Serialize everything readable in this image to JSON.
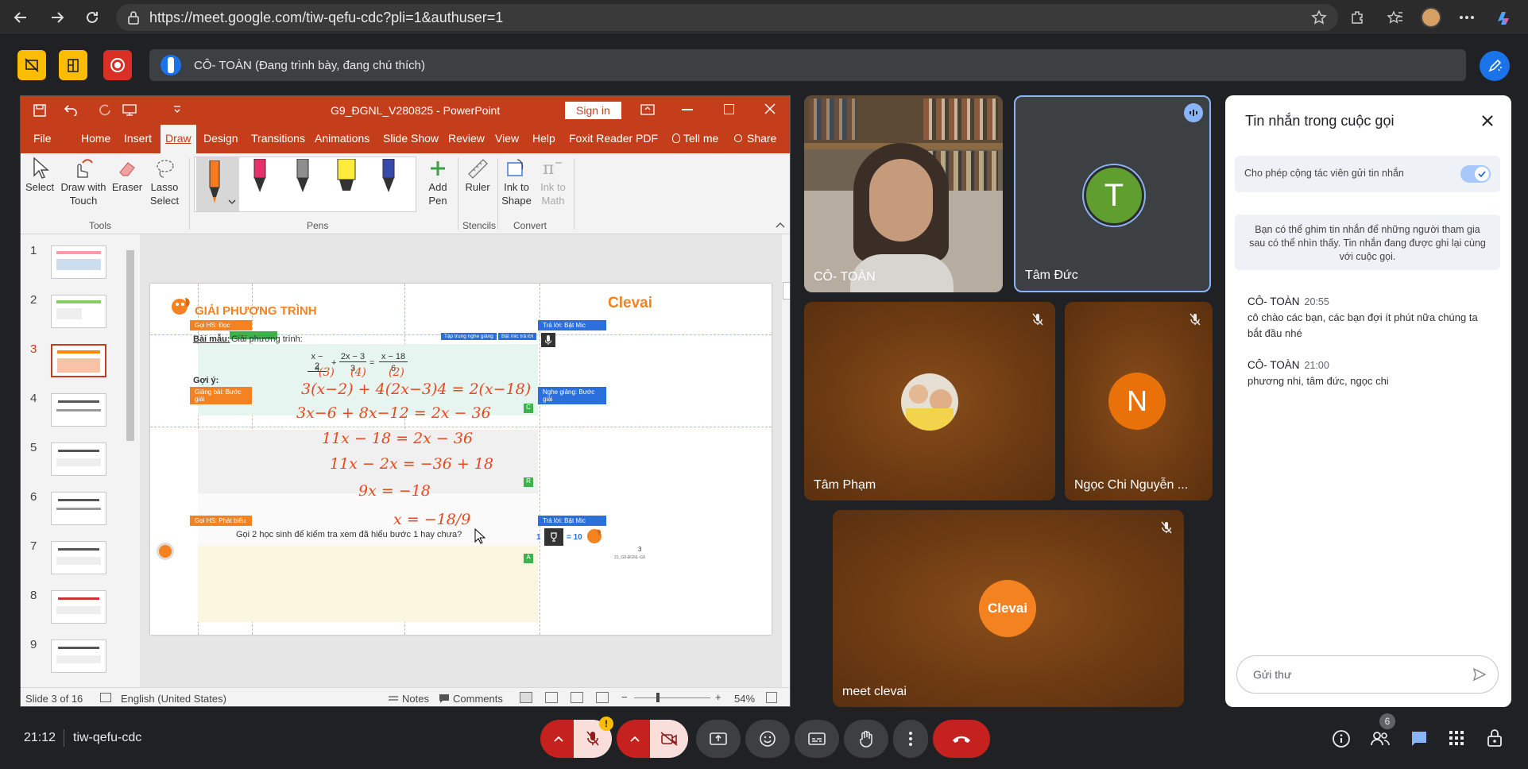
{
  "browser": {
    "url": "https://meet.google.com/tiw-qefu-cdc?pli=1&authuser=1"
  },
  "presentation_bar": {
    "text": "CÔ- TOÀN (Đang trình bày, đang chú thích)"
  },
  "ppt": {
    "file_title": "G9_ĐGNL_V280825  -  PowerPoint",
    "sign_in": "Sign in",
    "tabs": [
      "File",
      "Home",
      "Insert",
      "Draw",
      "Design",
      "Transitions",
      "Animations",
      "Slide Show",
      "Review",
      "View",
      "Help",
      "Foxit Reader PDF",
      "Tell me",
      "Share"
    ],
    "ribbon": {
      "select": "Select",
      "draw_touch": "Draw with Touch",
      "eraser": "Eraser",
      "lasso": "Lasso Select",
      "add_pen": "Add Pen",
      "ruler": "Ruler",
      "ink_shape": "Ink to Shape",
      "ink_math": "Ink to Math",
      "groups": {
        "tools": "Tools",
        "pens": "Pens",
        "stencils": "Stencils",
        "convert": "Convert"
      }
    },
    "thumb_numbers": [
      "1",
      "2",
      "3",
      "4",
      "5",
      "6",
      "7",
      "8",
      "9"
    ],
    "slide": {
      "heading": "GIẢI PHƯƠNG TRÌNH",
      "brand": "Clevai",
      "tag_goi_doc": "Gọi HS: Đọc",
      "tag_tra_loi_1": "Trả lời: Bật Mic",
      "tag_tap_trung": "Tập trung nghe giảng",
      "tag_bat_mic": "Bật mic trả lời",
      "bai_mau_label": "Bài mẫu:",
      "bai_mau_text": "Giải phương trình:",
      "eq_left1_num": "x − 2",
      "eq_left1_den": "4",
      "eq_plus": "+",
      "eq_left2_num": "2x − 3",
      "eq_left2_den": "3",
      "eq_eq": "=",
      "eq_right_num": "x − 18",
      "eq_right_den": "6",
      "goi_y": "Gợi ý:",
      "tag_giang_bai": "Giảng bài: Bước giải",
      "tag_nghe_giang": "Nghe giảng: Bước giải",
      "ink": [
        "(3)",
        "(4)",
        "(2)",
        "3(x−2) + 4(2x−3)4 = 2(x−18)",
        "3x−6 + 8x−12 = 2x − 36",
        "11x − 18 = 2x − 36",
        "11x − 2x = −36 + 18",
        "9x = −18",
        "x = −18/9"
      ],
      "tag_goi_phat_bieu": "Gọi HS: Phát biểu",
      "tag_tra_loi_2": "Trả lời: Bật Mic",
      "question": "Gọi 2 học sinh để kiểm tra xem đã hiểu bước 1 hay chưa?",
      "score_one": "1",
      "score_eq": "= 10",
      "page_num": "3",
      "footer_code": "21_G9-ĐGNL-G9",
      "letter_c": "C",
      "letter_r": "R",
      "letter_a": "A"
    },
    "status": {
      "slide": "Slide 3 of 16",
      "language": "English (United States)",
      "notes": "Notes",
      "comments": "Comments",
      "zoom": "54%"
    }
  },
  "participants": [
    {
      "name": "CÔ- TOÀN",
      "initial": ""
    },
    {
      "name": "Tâm Đức",
      "initial": "T",
      "color": "#5f9e2f"
    },
    {
      "name": "Tâm Phạm",
      "initial": ""
    },
    {
      "name": "Ngọc Chi Nguyễn ...",
      "initial": "N",
      "color": "#e8710a"
    },
    {
      "name": "meet clevai",
      "initial": "",
      "logo": "Clevai"
    }
  ],
  "chat": {
    "title": "Tin nhắn trong cuộc gọi",
    "allow_label": "Cho phép cộng tác viên gửi tin nhắn",
    "info": "Bạn có thể ghim tin nhắn để những người tham gia sau có thể nhìn thấy. Tin nhắn đang được ghi lại cùng với cuộc gọi.",
    "messages": [
      {
        "sender": "CÔ- TOÀN",
        "time": "20:55",
        "text": "cô chào các bạn, các bạn đợi ít phút nữa chúng ta bắt đầu nhé"
      },
      {
        "sender": "CÔ- TOÀN",
        "time": "21:00",
        "text": "phương nhi, tâm đức, ngọc chi"
      }
    ],
    "input_placeholder": "Gửi thư"
  },
  "bottom": {
    "time": "21:12",
    "meeting_code": "tiw-qefu-cdc",
    "people_count": "6",
    "mic_warning": "!"
  }
}
